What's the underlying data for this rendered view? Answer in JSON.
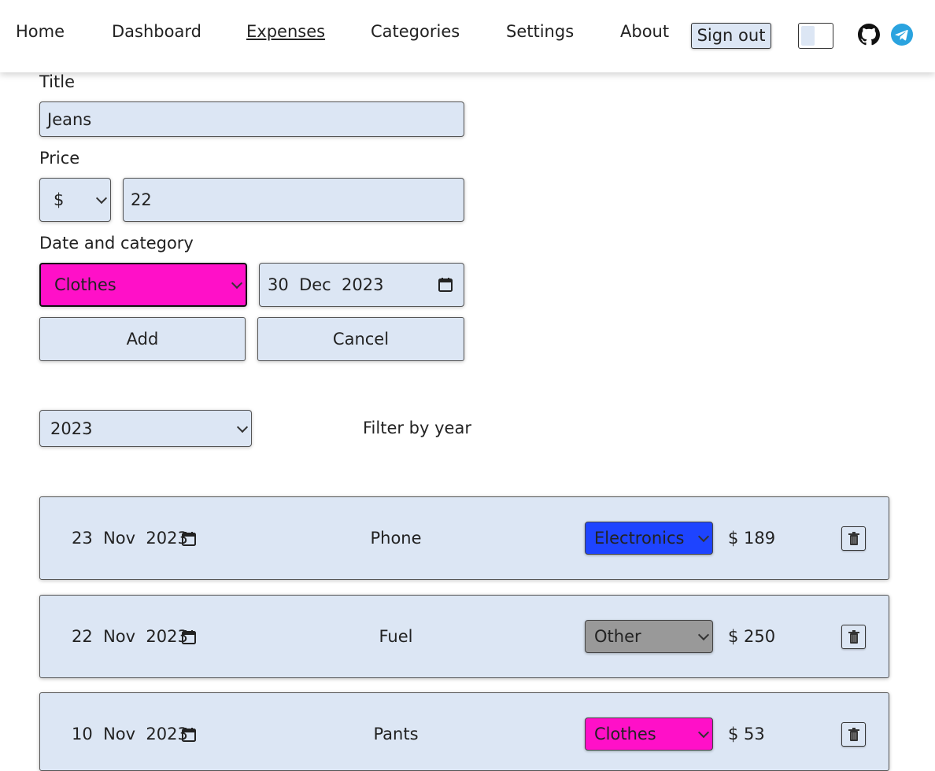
{
  "nav": {
    "home": "Home",
    "dashboard": "Dashboard",
    "expenses": "Expenses",
    "categories": "Categories",
    "settings": "Settings",
    "about": "About",
    "sign_out": "Sign out",
    "theme_toggle_icon": "toggle",
    "github_icon": "github-icon",
    "telegram_icon": "telegram-icon"
  },
  "form": {
    "title_label": "Title",
    "title_value": "Jeans",
    "price_label": "Price",
    "currency": "$",
    "price_value": "22",
    "date_category_label": "Date and category",
    "category_value": "Clothes",
    "category_color": "#ff10c8",
    "date_value": "30  Dec  2023",
    "add_label": "Add",
    "cancel_label": "Cancel"
  },
  "filter": {
    "year_value": "2023",
    "label": "Filter by year"
  },
  "expenses": [
    {
      "date": "23  Nov  2023",
      "title": "Phone",
      "category": "Electronics",
      "category_color": "#1e44ff",
      "price": "$ 189"
    },
    {
      "date": "22  Nov  2023",
      "title": "Fuel",
      "category": "Other",
      "category_color": "#999999",
      "price": "$ 250"
    },
    {
      "date": "10  Nov  2023",
      "title": "Pants",
      "category": "Clothes",
      "category_color": "#ff10c8",
      "price": "$ 53"
    }
  ]
}
